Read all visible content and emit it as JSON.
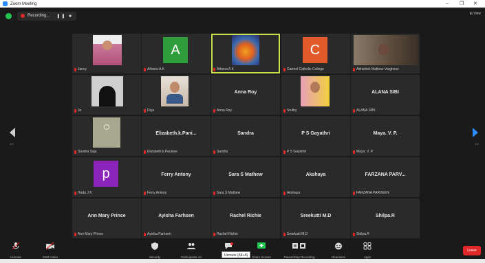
{
  "window": {
    "title": "Zoom Meeting",
    "controls": [
      "–",
      "❐",
      "✕"
    ]
  },
  "topbar": {
    "recording_label": "Recording...",
    "pause_stop": "❚❚ ■",
    "view_label": "⊞ View"
  },
  "pager": {
    "left": "1/3",
    "right": "1/3"
  },
  "tiles": [
    {
      "name": "Jancy",
      "kind": "photo",
      "photo": "woman-pink"
    },
    {
      "name": "Athena A.K",
      "kind": "avatar",
      "letter": "A",
      "color": "#2e9e3d"
    },
    {
      "name": "Athena A.K",
      "kind": "photo",
      "photo": "lion"
    },
    {
      "name": "Carmel Catholic College",
      "kind": "avatar",
      "letter": "C",
      "color": "#e25a2a"
    },
    {
      "name": "Abhishek Mathew Varghese",
      "kind": "photo",
      "photo": "man"
    },
    {
      "name": "Jo",
      "kind": "photo",
      "photo": "niqab"
    },
    {
      "name": "Diya",
      "kind": "photo",
      "photo": "girl"
    },
    {
      "name": "Anna Roy",
      "kind": "text",
      "big": "Anna Roy"
    },
    {
      "name": "Sruthy",
      "kind": "photo",
      "photo": "girl2"
    },
    {
      "name": "ALANA SIBI",
      "kind": "text",
      "big": "ALANA SIBI"
    },
    {
      "name": "Sandra Saju",
      "kind": "photo",
      "photo": "sketch"
    },
    {
      "name": "Elizabeth.k.Paulose",
      "kind": "text",
      "big": "Elizabeth.k.Pani..."
    },
    {
      "name": "Sandra",
      "kind": "text",
      "big": "Sandra"
    },
    {
      "name": "P S Gayathri",
      "kind": "text",
      "big": "P S Gayathri"
    },
    {
      "name": "Maya. V. P.",
      "kind": "text",
      "big": "Maya. V. P."
    },
    {
      "name": "Huda J K",
      "kind": "avatar",
      "letter": "p",
      "color": "#8b24b8"
    },
    {
      "name": "Ferry Antony",
      "kind": "text",
      "big": "Ferry Antony"
    },
    {
      "name": "Sara S Mathew",
      "kind": "text",
      "big": "Sara S Mathew"
    },
    {
      "name": "Akshaya",
      "kind": "text",
      "big": "Akshaya"
    },
    {
      "name": "FARZANA PARVEEN",
      "kind": "text",
      "big": "FARZANA PARV..."
    },
    {
      "name": "Ann Mary Prince",
      "kind": "text",
      "big": "Ann Mary Prince"
    },
    {
      "name": "Ayisha Farhsen",
      "kind": "text",
      "big": "Ayisha Farhsen"
    },
    {
      "name": "Rachel Richie",
      "kind": "text",
      "big": "Rachel Richie"
    },
    {
      "name": "Sreekutti M.D",
      "kind": "text",
      "big": "Sreekutti M.D"
    },
    {
      "name": "Shilpa.R",
      "kind": "text",
      "big": "Shilpa.R"
    }
  ],
  "toolbar": {
    "unmute": "Unmute",
    "start_video": "Start Video",
    "security": "Security",
    "participants": "Participants",
    "participants_count": "44",
    "chat_badge": "2",
    "share": "Share Screen",
    "pause_recording": "Pause/Stop Recording",
    "reactions": "Reactions",
    "apps": "Apps",
    "leave": "Leave",
    "tooltip": "Unmute (Alt+A)"
  },
  "colors": {
    "background": "#1a1a1a",
    "tile": "#2a2a2a",
    "accent": "#2d8cff",
    "leave": "#e02828",
    "active_speaker": "#c8e04c"
  }
}
